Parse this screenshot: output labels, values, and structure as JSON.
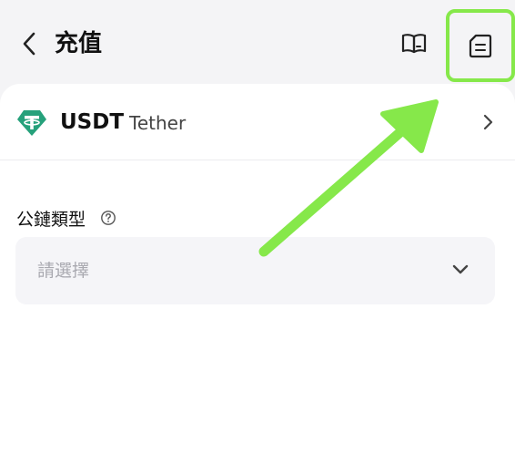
{
  "header": {
    "title": "充值",
    "back_icon": "chevron-left-icon",
    "guide_icon": "book-icon",
    "records_icon": "document-icon",
    "highlight_color": "#86e84a"
  },
  "coin": {
    "symbol": "USDT",
    "name": "Tether",
    "icon": "tether-icon",
    "icon_color": "#26a17b"
  },
  "network": {
    "label": "公鏈類型",
    "help_icon": "question-circle-icon",
    "placeholder": "請選擇",
    "dropdown_icon": "chevron-down-icon"
  },
  "annotation": {
    "arrow_color": "#86e84a"
  }
}
